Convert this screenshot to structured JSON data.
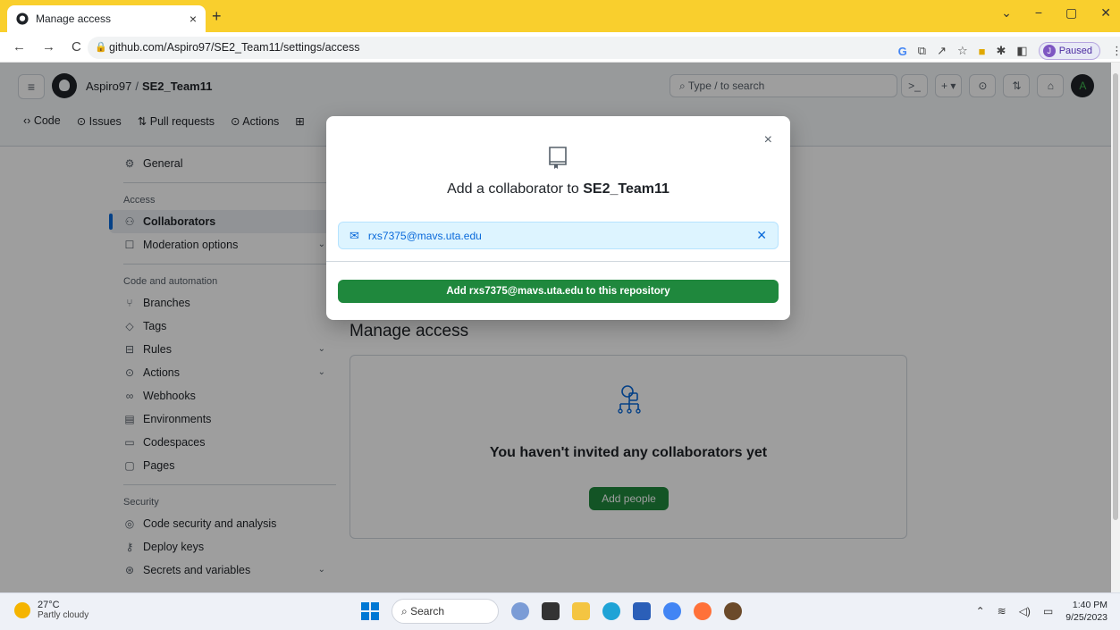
{
  "browser": {
    "tab_title": "Manage access",
    "tab_close": "×",
    "new_tab": "+",
    "url": "github.com/Aspiro97/SE2_Team11/settings/access",
    "profile_status": "Paused",
    "profile_initial": "J"
  },
  "header": {
    "owner": "Aspiro97",
    "separator": "/",
    "repo": "SE2_Team11",
    "search_placeholder": "Type / to search",
    "avatar_letter": "A"
  },
  "repo_nav": [
    {
      "label": "Code"
    },
    {
      "label": "Issues"
    },
    {
      "label": "Pull requests"
    },
    {
      "label": "Actions"
    }
  ],
  "sidebar": {
    "general": "General",
    "access_head": "Access",
    "collaborators": "Collaborators",
    "moderation": "Moderation options",
    "code_head": "Code and automation",
    "branches": "Branches",
    "tags": "Tags",
    "rules": "Rules",
    "actions": "Actions",
    "webhooks": "Webhooks",
    "environments": "Environments",
    "codespaces": "Codespaces",
    "pages": "Pages",
    "security_head": "Security",
    "code_security": "Code security and analysis",
    "deploy_keys": "Deploy keys",
    "secrets": "Secrets and variables"
  },
  "main": {
    "title": "Manage access",
    "empty_text": "You haven't invited any collaborators yet",
    "add_people": "Add people"
  },
  "modal": {
    "heading_prefix": "Add a collaborator to",
    "repo": "SE2_Team11",
    "email": "rxs7375@mavs.uta.edu",
    "submit_label": "Add rxs7375@mavs.uta.edu to this repository",
    "close": "×"
  },
  "taskbar": {
    "temperature": "27°C",
    "weather": "Partly cloudy",
    "search": "Search",
    "time": "1:40 PM",
    "date": "9/25/2023"
  },
  "colors": {
    "accent": "#0969da",
    "primary_button": "#1f883d",
    "chrome_frame": "#f9cf2d"
  }
}
